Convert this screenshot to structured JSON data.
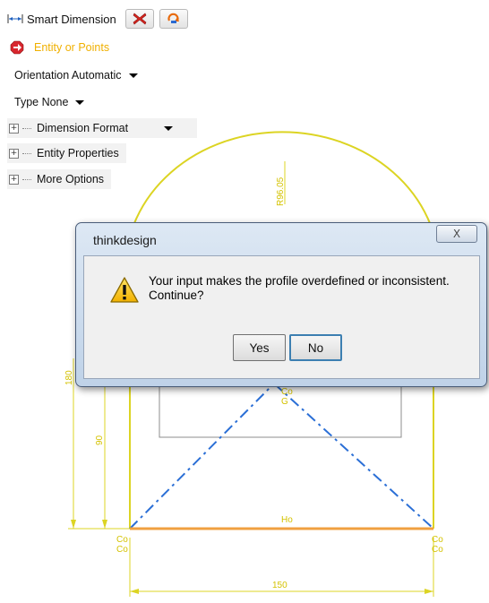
{
  "command": {
    "title": "Smart Dimension",
    "title_icon": "dimension-icon",
    "cancel_icon": "red-x-icon",
    "ok_icon": "orange-arrow-icon",
    "prompt": "Entity or Points",
    "prompt_icon": "red-stop-icon"
  },
  "options": {
    "orientation_label": "Orientation Automatic",
    "type_label": "Type None",
    "groups": [
      {
        "label": "Dimension Format",
        "expander": "+"
      },
      {
        "label": "Entity Properties",
        "expander": "+"
      },
      {
        "label": "More Options",
        "expander": "+"
      }
    ]
  },
  "drawing": {
    "dim_radius": "R96.05",
    "dim_height": "180",
    "dim_inner_height": "90",
    "dim_width": "150",
    "label_ho": "Ho",
    "label_co": "Co",
    "label_g": "G",
    "colors": {
      "dimension": "#d6cd1e",
      "construction": "#2b6fd6",
      "bottom_edge": "#f0a040",
      "profile": "#7a7a7a"
    }
  },
  "dialog": {
    "title": "thinkdesign",
    "close_glyph": "X",
    "icon": "warning-icon",
    "message": "Your input makes the profile overdefined or inconsistent. Continue?",
    "yes_label": "Yes",
    "no_label": "No"
  }
}
